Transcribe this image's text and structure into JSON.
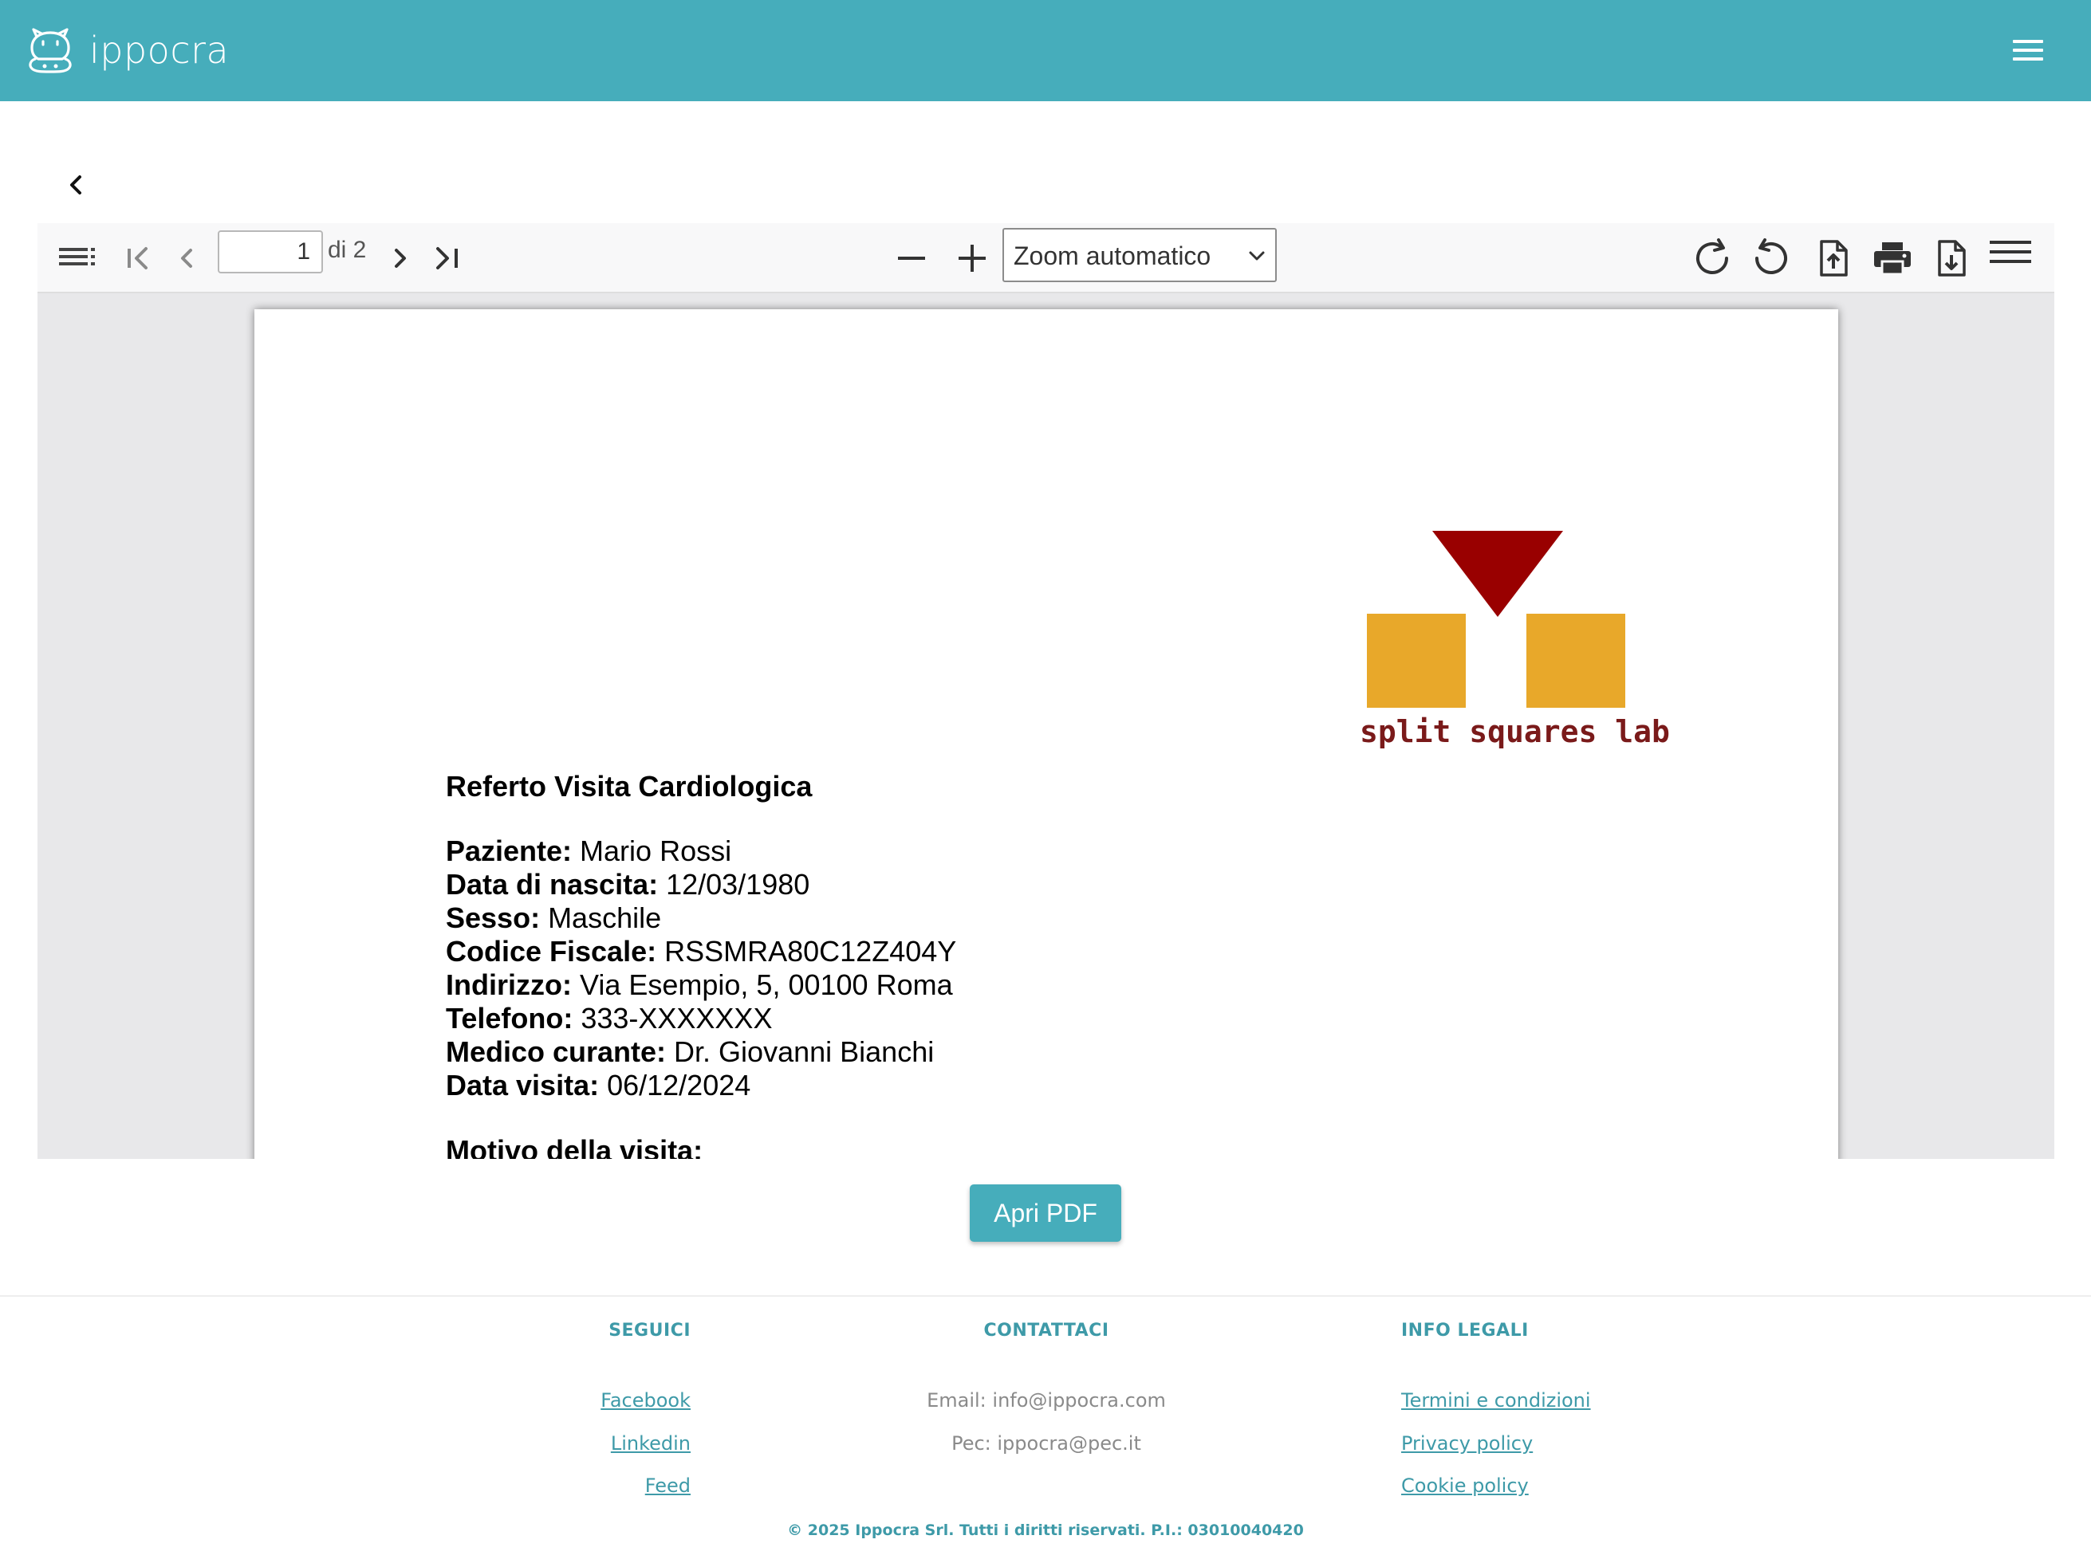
{
  "header": {
    "brand": "ippocra",
    "menu_icon": "hamburger-icon",
    "color": "#46adbb"
  },
  "back_icon": "chevron-left-icon",
  "viewer": {
    "toolbar": {
      "sidebar_icon": "sidebar-toggle-icon",
      "first_icon": "first-page-icon",
      "prev_icon": "previous-page-icon",
      "page_value": "1",
      "page_total": "di 2",
      "next_icon": "next-page-icon",
      "last_icon": "last-page-icon",
      "zoom_out_icon": "minus-icon",
      "zoom_in_icon": "plus-icon",
      "zoom_value": "Zoom automatico",
      "rotate_cw_icon": "rotate-clockwise-icon",
      "rotate_ccw_icon": "rotate-counterclockwise-icon",
      "open_file_icon": "open-file-icon",
      "print_icon": "print-icon",
      "download_icon": "download-icon",
      "tools_icon": "tools-menu-icon"
    },
    "document": {
      "logo_text": "split squares lab",
      "title": "Referto Visita Cardiologica",
      "fields": [
        {
          "label": "Paziente:",
          "value": " Mario Rossi"
        },
        {
          "label": "Data di nascita:",
          "value": " 12/03/1980"
        },
        {
          "label": "Sesso:",
          "value": " Maschile"
        },
        {
          "label": "Codice Fiscale:",
          "value": " RSSMRA80C12Z404Y"
        },
        {
          "label": "Indirizzo:",
          "value": " Via Esempio, 5, 00100 Roma"
        },
        {
          "label": "Telefono:",
          "value": " 333-XXXXXXX"
        },
        {
          "label": "Medico curante:",
          "value": " Dr. Giovanni Bianchi"
        },
        {
          "label": "Data visita:",
          "value": " 06/12/2024"
        }
      ],
      "next_section": "Motivo della visita:"
    }
  },
  "open_pdf_label": "Apri PDF",
  "footer": {
    "follow": {
      "heading": "SEGUICI",
      "links": [
        "Facebook",
        "Linkedin",
        "Feed"
      ]
    },
    "contact": {
      "heading": "CONTATTACI",
      "email": "Email: info@ippocra.com",
      "pec": "Pec: ippocra@pec.it"
    },
    "legal": {
      "heading": "INFO LEGALI",
      "links": [
        "Termini e condizioni",
        "Privacy policy",
        "Cookie policy"
      ]
    },
    "copyright": "© 2025 Ippocra Srl. Tutti i diritti riservati. P.I.: 03010040420"
  },
  "colors": {
    "accent": "#46adbb",
    "footer_text": "#3e9aa8",
    "logo_red": "#990000",
    "logo_yellow": "#e8a82a"
  }
}
